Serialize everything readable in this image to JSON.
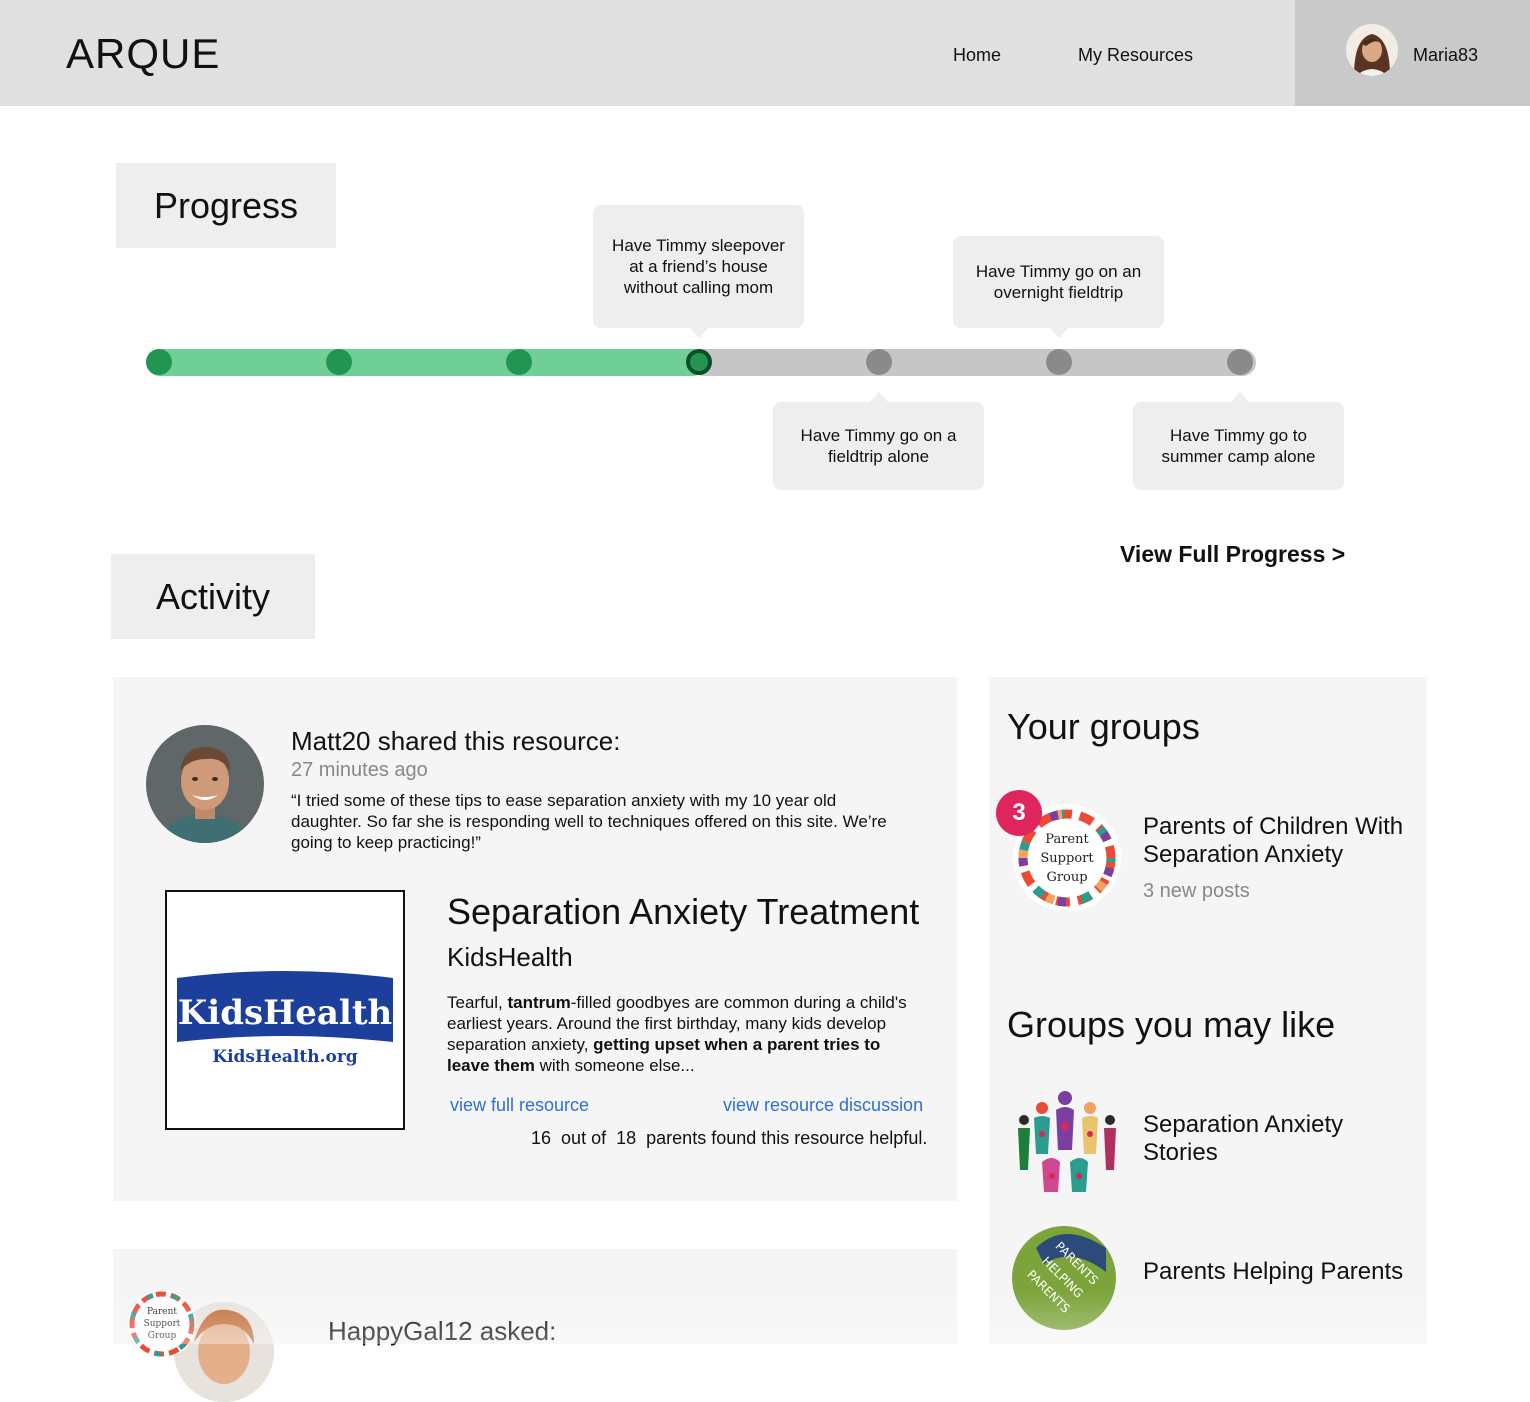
{
  "header": {
    "logo": "ARQUE",
    "nav": [
      "Home",
      "My Resources"
    ],
    "username": "Maria83"
  },
  "progress": {
    "heading": "Progress",
    "milestones_completed": 4,
    "milestones_total": 7,
    "current_milestone": 4,
    "milestones": [
      {
        "label": "Have Timmy sleepover at a friend’s house without calling mom"
      },
      {
        "label": "Have Timmy go on a fieldtrip alone"
      },
      {
        "label": "Have Timmy go on an overnight fieldtrip"
      },
      {
        "label": "Have Timmy go to summer camp alone"
      }
    ],
    "view_full": "View Full Progress >"
  },
  "activity": {
    "heading": "Activity",
    "post": {
      "title": "Matt20 shared this resource:",
      "time": "27 minutes ago",
      "quote": "“I tried some of these tips to ease separation anxiety with my 10 year old daughter. So far she is responding well to techniques offered on this site. We’re going to keep practicing!”",
      "resource": {
        "title": "Separation Anxiety Treatment",
        "source": "KidsHealth",
        "logo_text": "KidsHealth",
        "logo_url_text": "KidsHealth.org",
        "desc_1": "Tearful, ",
        "desc_b1": "tantrum",
        "desc_2": "-filled goodbyes are common during a child's earliest years. Around the first birthday, many kids develop separation anxiety, ",
        "desc_b2": "getting upset when a parent tries to leave them",
        "desc_3": " with someone else...",
        "link_full": "view full resource",
        "link_discussion": "view resource discussion",
        "helpful_count": "16",
        "helpful_mid": "out of",
        "helpful_total": "18",
        "helpful_suffix": "parents found this resource helpful."
      }
    },
    "post2": {
      "title": "HappyGal12 asked:",
      "logo_text_1": "Parent",
      "logo_text_2": "Support",
      "logo_text_3": "Group"
    }
  },
  "groups": {
    "your_heading": "Your groups",
    "your": [
      {
        "name": "Parents of Children With Separation Anxiety",
        "badge": "3",
        "posts": "3 new posts",
        "logo_text_1": "Parent",
        "logo_text_2": "Support",
        "logo_text_3": "Group"
      }
    ],
    "suggest_heading": "Groups you may like",
    "suggested": [
      {
        "name": "Separation Anxiety Stories"
      },
      {
        "name": "Parents Helping Parents",
        "logo_text_1": "PARENTS",
        "logo_text_2": "HELPING",
        "logo_text_3": "PARENTS"
      }
    ]
  },
  "colors": {
    "progress_done": "#6fcf97",
    "progress_dot": "#219653",
    "progress_todo": "#c6c6c6",
    "link": "#2f6fd6",
    "badge": "#e0245e"
  }
}
